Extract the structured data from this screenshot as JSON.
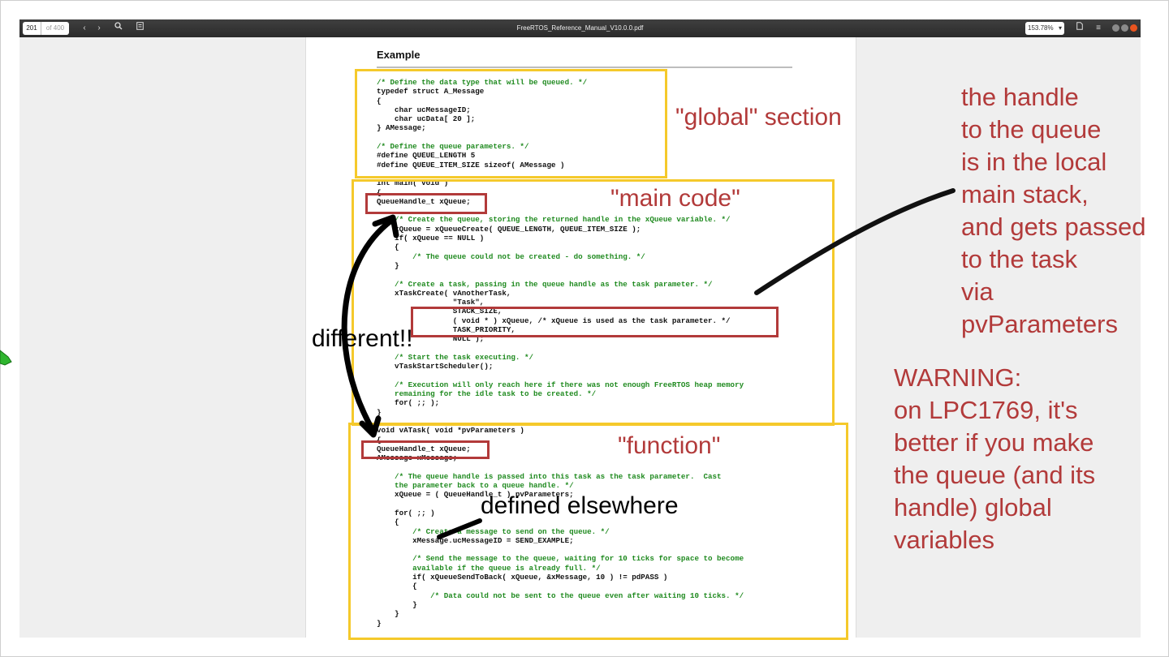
{
  "viewer": {
    "page_current": "201",
    "page_total": "of 400",
    "file_title": "FreeRTOS_Reference_Manual_V10.0.0.pdf",
    "zoom": "153.78%"
  },
  "page": {
    "heading": "Example",
    "code_lines": [
      {
        "t": "/* Define the data type that will be queued. */",
        "c": true
      },
      {
        "t": "typedef struct A_Message",
        "c": false
      },
      {
        "t": "{",
        "c": false
      },
      {
        "t": "    char ucMessageID;",
        "c": false
      },
      {
        "t": "    char ucData[ 20 ];",
        "c": false
      },
      {
        "t": "} AMessage;",
        "c": false
      },
      {
        "t": "",
        "c": false
      },
      {
        "t": "/* Define the queue parameters. */",
        "c": true
      },
      {
        "t": "#define QUEUE_LENGTH 5",
        "c": false
      },
      {
        "t": "#define QUEUE_ITEM_SIZE sizeof( AMessage )",
        "c": false
      },
      {
        "t": "",
        "c": false
      },
      {
        "t": "int main( void )",
        "c": false
      },
      {
        "t": "{",
        "c": false
      },
      {
        "t": "QueueHandle_t xQueue;",
        "c": false
      },
      {
        "t": "",
        "c": false
      },
      {
        "t": "    /* Create the queue, storing the returned handle in the xQueue variable. */",
        "c": true
      },
      {
        "t": "    xQueue = xQueueCreate( QUEUE_LENGTH, QUEUE_ITEM_SIZE );",
        "c": false
      },
      {
        "t": "    if( xQueue == NULL )",
        "c": false
      },
      {
        "t": "    {",
        "c": false
      },
      {
        "t": "        /* The queue could not be created - do something. */",
        "c": true
      },
      {
        "t": "    }",
        "c": false
      },
      {
        "t": "",
        "c": false
      },
      {
        "t": "    /* Create a task, passing in the queue handle as the task parameter. */",
        "c": true
      },
      {
        "t": "    xTaskCreate( vAnotherTask,",
        "c": false
      },
      {
        "t": "                 \"Task\",",
        "c": false
      },
      {
        "t": "                 STACK_SIZE,",
        "c": false
      },
      {
        "t": "                 ( void * ) xQueue, /* xQueue is used as the task parameter. */",
        "c": false
      },
      {
        "t": "                 TASK_PRIORITY,",
        "c": false
      },
      {
        "t": "                 NULL );",
        "c": false
      },
      {
        "t": "",
        "c": false
      },
      {
        "t": "    /* Start the task executing. */",
        "c": true
      },
      {
        "t": "    vTaskStartScheduler();",
        "c": false
      },
      {
        "t": "",
        "c": false
      },
      {
        "t": "    /* Execution will only reach here if there was not enough FreeRTOS heap memory",
        "c": true
      },
      {
        "t": "    remaining for the idle task to be created. */",
        "c": true
      },
      {
        "t": "    for( ;; );",
        "c": false
      },
      {
        "t": "}",
        "c": false
      },
      {
        "t": "",
        "c": false
      },
      {
        "t": "void vATask( void *pvParameters )",
        "c": false
      },
      {
        "t": "{",
        "c": false
      },
      {
        "t": "QueueHandle_t xQueue;",
        "c": false
      },
      {
        "t": "AMessage xMessage;",
        "c": false
      },
      {
        "t": "",
        "c": false
      },
      {
        "t": "    /* The queue handle is passed into this task as the task parameter.  Cast",
        "c": true
      },
      {
        "t": "    the parameter back to a queue handle. */",
        "c": true
      },
      {
        "t": "    xQueue = ( QueueHandle_t ) pvParameters;",
        "c": false
      },
      {
        "t": "",
        "c": false
      },
      {
        "t": "    for( ;; )",
        "c": false
      },
      {
        "t": "    {",
        "c": false
      },
      {
        "t": "        /* Create a message to send on the queue. */",
        "c": true
      },
      {
        "t": "        xMessage.ucMessageID = SEND_EXAMPLE;",
        "c": false
      },
      {
        "t": "",
        "c": false
      },
      {
        "t": "        /* Send the message to the queue, waiting for 10 ticks for space to become",
        "c": true
      },
      {
        "t": "        available if the queue is already full. */",
        "c": true
      },
      {
        "t": "        if( xQueueSendToBack( xQueue, &xMessage, 10 ) != pdPASS )",
        "c": false
      },
      {
        "t": "        {",
        "c": false
      },
      {
        "t": "            /* Data could not be sent to the queue even after waiting 10 ticks. */",
        "c": true
      },
      {
        "t": "        }",
        "c": false
      },
      {
        "t": "    }",
        "c": false
      },
      {
        "t": "}",
        "c": false
      }
    ]
  },
  "annotations": {
    "global_label": "\"global\" section",
    "main_label": "\"main code\"",
    "function_label": "\"function\"",
    "different_label": "different!!",
    "elsewhere_label": "defined elsewhere",
    "handle_note": "the handle\nto the queue\nis in the local\nmain stack,\nand gets passed\nto the task\nvia\npvParameters",
    "warning_note": "WARNING:\non LPC1769, it's\nbetter if you make\nthe queue (and its\nhandle) global\nvariables"
  },
  "colors": {
    "section_box": "#f5c92b",
    "highlight_box": "#b23a3a",
    "note_text": "#b23a3a",
    "code_comment": "#1f8a1f"
  }
}
